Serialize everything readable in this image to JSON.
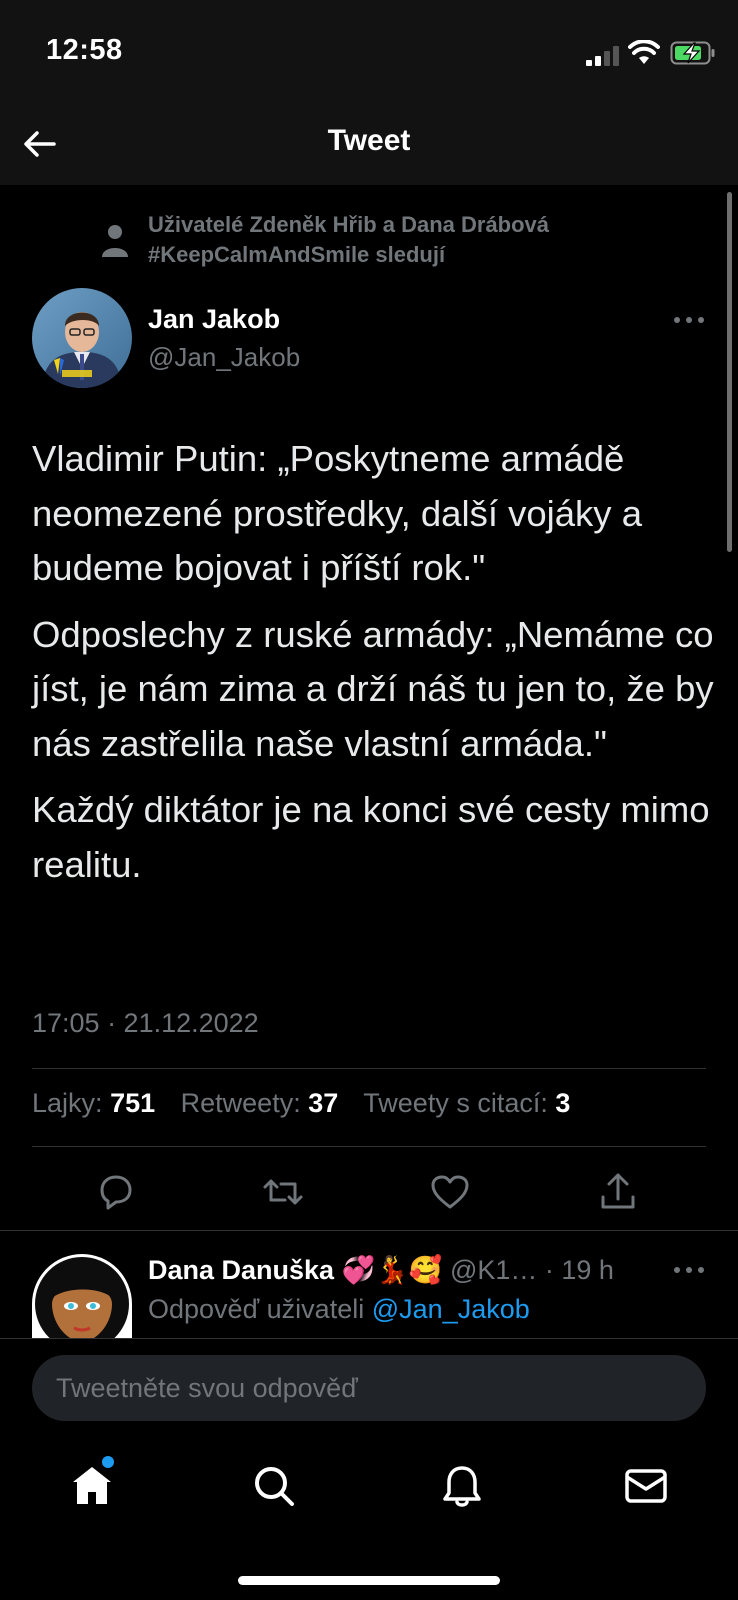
{
  "status_bar": {
    "time": "12:58"
  },
  "header": {
    "title": "Tweet"
  },
  "social_context": {
    "text": "Uživatelé Zdeněk Hřib a Dana Drábová #KeepCalmAndSmile sledují"
  },
  "author": {
    "name": "Jan Jakob",
    "handle": "@Jan_Jakob"
  },
  "tweet": {
    "paragraphs": [
      "Vladimir Putin: „Poskytneme armádě neomezené prostředky, další vojáky a budeme bojovat i příští rok.\"",
      "Odposlechy z ruské armády: „Nemáme co jíst, je nám zima a drží náš tu jen to, že by nás zastřelila naše vlastní armáda.\"",
      "Každý diktátor je na konci své cesty mimo realitu."
    ],
    "timestamp": "17:05 · 21.12.2022"
  },
  "stats": {
    "likes_label": "Lajky:",
    "likes": "751",
    "retweets_label": "Retweety:",
    "retweets": "37",
    "quotes_label": "Tweety s citací:",
    "quotes": "3"
  },
  "actions": [
    "reply-icon",
    "retweet-icon",
    "like-icon",
    "share-icon"
  ],
  "reply": {
    "name": "Dana Danuška 💞💃🥰",
    "handle": "@K1…",
    "time": "· 19 h",
    "reply_to_label": "Odpověď uživateli",
    "reply_to_handle": "@Jan_Jakob"
  },
  "composer": {
    "placeholder": "Tweetněte svou odpověď"
  },
  "tabs": [
    "home-icon",
    "search-icon",
    "bell-icon",
    "mail-icon"
  ],
  "colors": {
    "accent": "#1d9bf0",
    "background": "#000000",
    "muted": "#71767b"
  }
}
